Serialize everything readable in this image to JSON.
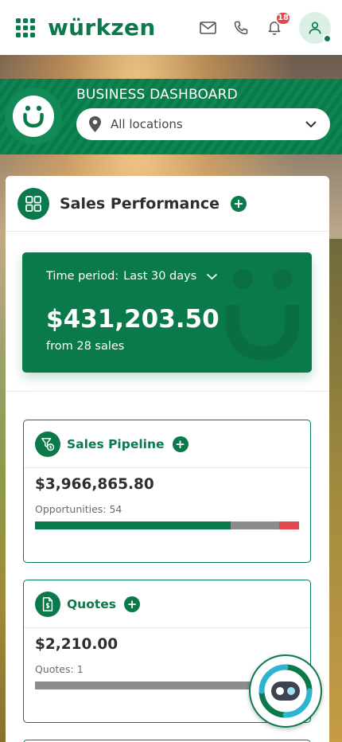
{
  "app": {
    "logo_text": "würkzen"
  },
  "topbar": {
    "notifications_count": "18",
    "icons": [
      "apps-grid-icon",
      "mail-icon",
      "phone-icon",
      "bell-icon",
      "user-icon"
    ]
  },
  "banner": {
    "title": "BUSINESS DASHBOARD",
    "location_value": "All locations"
  },
  "sales_performance": {
    "title": "Sales Performance",
    "add_label": "+",
    "period_label": "Time period:",
    "period_value": "Last 30 days",
    "total_amount": "$431,203.50",
    "total_sub": "from 28 sales"
  },
  "sales_pipeline": {
    "title": "Sales Pipeline",
    "add_label": "+",
    "amount": "$3,966,865.80",
    "count_label": "Opportunities: 54",
    "bar_segments": [
      {
        "name": "green",
        "fraction": 0.74,
        "color": "#0b7a4b"
      },
      {
        "name": "gray",
        "fraction": 0.185,
        "color": "#8a8c8e"
      },
      {
        "name": "red",
        "fraction": 0.075,
        "color": "#e2474f"
      }
    ]
  },
  "quotes": {
    "title": "Quotes",
    "add_label": "+",
    "amount": "$2,210.00",
    "count_label": "Quotes: 1",
    "bar_segments": [
      {
        "name": "gray",
        "fraction": 1.0,
        "color": "#8a8c8e"
      }
    ]
  },
  "colors": {
    "brand_green": "#0b7a4b",
    "badge_red": "#e2474f"
  }
}
